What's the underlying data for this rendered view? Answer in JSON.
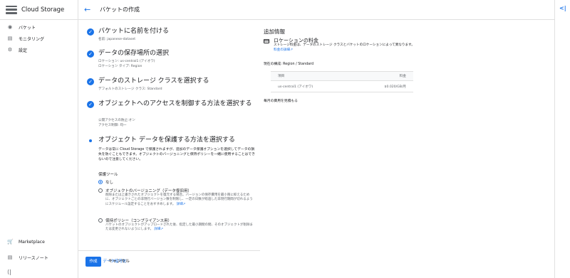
{
  "app": {
    "title": "Cloud Storage"
  },
  "nav": {
    "items": [
      {
        "label": "バケット",
        "icon": "bucket-icon"
      },
      {
        "label": "モニタリング",
        "icon": "chart-icon"
      },
      {
        "label": "設定",
        "icon": "gear-icon"
      }
    ],
    "bottom": [
      {
        "label": "Marketplace",
        "icon": "cart-icon"
      },
      {
        "label": "リリースノート",
        "icon": "notes-icon"
      }
    ],
    "collapse_icon": "collapse-icon"
  },
  "header": {
    "title": "バケットの作成"
  },
  "steps": [
    {
      "title": "バケットに名前を付ける",
      "sub": [
        "名前: japanese-dataset"
      ]
    },
    {
      "title": "データの保存場所の選択",
      "sub": [
        "ロケーション: us-central1 (アイオワ)",
        "ロケーション タイプ: Region"
      ]
    },
    {
      "title": "データのストレージ クラスを選択する",
      "sub": [
        "デフォルトのストレージ クラス: Standard"
      ]
    },
    {
      "title": "オブジェクトへのアクセスを制御する方法を選択する",
      "sub": [
        "公開アクセスの防止:オン",
        "アクセス制御: 均一"
      ]
    },
    {
      "title": "オブジェクト データを保護する方法を選択する"
    }
  ],
  "protect": {
    "desc": "データは常に Cloud Storage で保護されますが、追加のデータ保護オプションを選択してデータの損失を防ぐこともできます。オブジェクトのバージョニングと保持ポリシーを一緒に使用することはできないので注意してください。",
    "label": "保護ツール",
    "options": [
      {
        "label": "なし",
        "selected": true
      },
      {
        "label": "オブジェクトのバージョニング（データ復旧用）",
        "selected": false,
        "desc": "削除または上書きされたオブジェクトを復元する場合。バージョンの保存費用を最小限に抑えるために、オブジェクトごとの非現行バージョン数を制限し、一定の日数が経過した非現行期間が切れるようにスケジュール設定することをおすすめします。",
        "link": "詳細"
      },
      {
        "label": "保持ポリシー（コンプライアンス用）",
        "selected": false,
        "desc": "バケットのオブジェクトがアップロードされた後、指定した最小期間の間、そのオブジェクトが削除または変更されないようにします。",
        "link": "詳細"
      }
    ],
    "expand": "データ暗号化"
  },
  "actions": {
    "create": "作成",
    "cancel": "キャンセル"
  },
  "info": {
    "heading": "追加情報",
    "title": "ロケーションの料金",
    "text": "ストレージ料金は、データのストレージ クラスとバケットのロケーションによって異なります。",
    "text_link": "料金の詳細",
    "config": "現在の構成: Region / Standard",
    "table": {
      "headers": [
        "項目",
        "料金"
      ],
      "rows": [
        [
          "us-central1 (アイオワ)",
          "$0.020/GB/月"
        ]
      ]
    },
    "monthly": "毎月の費用を見積もる"
  }
}
